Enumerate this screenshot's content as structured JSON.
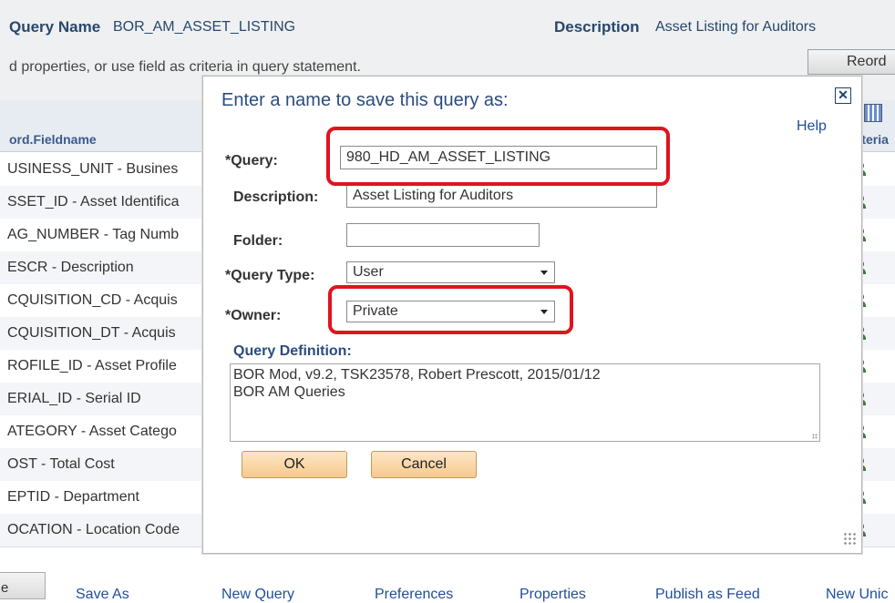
{
  "header": {
    "query_name_label": "Query Name",
    "query_name_value": "BOR_AM_ASSET_LISTING",
    "description_label": "Description",
    "description_value": "Asset Listing for Auditors",
    "hint_text": "d properties, or use field as criteria in query statement.",
    "reorder_label": "Reord"
  },
  "grid": {
    "col_field": "ord.Fieldname",
    "col_criteria": "riteria",
    "rows": [
      "USINESS_UNIT - Busines",
      "SSET_ID - Asset Identifica",
      "AG_NUMBER - Tag Numb",
      "ESCR - Description",
      "CQUISITION_CD - Acquis",
      "CQUISITION_DT - Acquis",
      "ROFILE_ID - Asset Profile",
      "ERIAL_ID - Serial ID",
      "ATEGORY - Asset Catego",
      "OST - Total Cost",
      "EPTID - Department",
      "OCATION - Location Code"
    ]
  },
  "footer": {
    "button_label": "e",
    "links": [
      "Save As",
      "New Query",
      "Preferences",
      "Properties",
      "Publish as Feed",
      "New Unic"
    ]
  },
  "modal": {
    "title": "Enter a name to save this query as:",
    "close_glyph": "✕",
    "help_label": "Help",
    "query_label": "*Query:",
    "query_value": "980_HD_AM_ASSET_LISTING",
    "description_label": "Description:",
    "description_value": "Asset Listing for Auditors",
    "folder_label": "Folder:",
    "folder_value": "",
    "query_type_label": "*Query Type:",
    "query_type_value": "User",
    "owner_label": "*Owner:",
    "owner_value": "Private",
    "definition_label": "Query Definition:",
    "definition_line1": "BOR Mod, v9.2, TSK23578, Robert Prescott, 2015/01/12",
    "definition_line2": "BOR AM Queries",
    "ok_label": "OK",
    "cancel_label": "Cancel"
  },
  "colors": {
    "highlight": "#e0141e",
    "title": "#2b4c7e",
    "link": "#1f4e9c",
    "button_fill": "#f7c98e"
  }
}
